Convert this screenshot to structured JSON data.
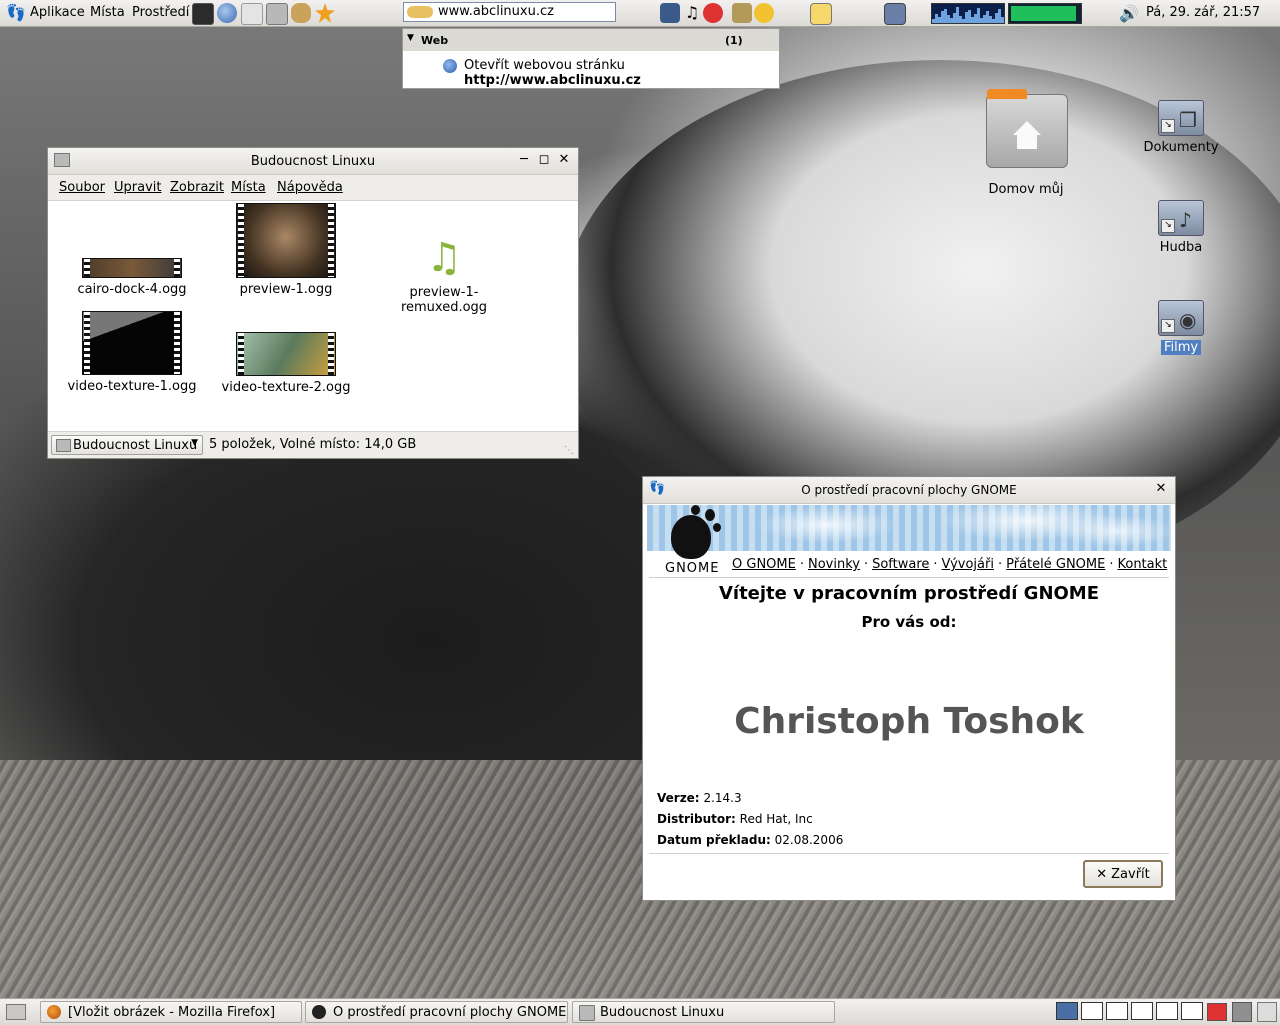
{
  "top_panel": {
    "menus": [
      "Aplikace",
      "Místa",
      "Prostředí"
    ],
    "launchers": [
      "terminal-icon",
      "globe-icon",
      "mail-icon",
      "calculator-icon",
      "gimp-icon",
      "star-icon"
    ],
    "url_value": "www.abclinuxu.cz",
    "tray_icons": [
      "network-icon",
      "music-icon",
      "alert-icon",
      "printer-icon",
      "smiley-icon",
      "windows-icon",
      "monitor-icon"
    ],
    "clock": "Pá, 29. zář, 21:57",
    "cpu_fill": 0.95
  },
  "url_dropdown": {
    "group": "Web",
    "count": "(1)",
    "action": "Otevřít webovou stránku",
    "url": "http://www.abclinuxu.cz"
  },
  "desktop_icons": {
    "home": "Domov můj",
    "documents": "Dokumenty",
    "music": "Hudba",
    "films": "Filmy"
  },
  "file_manager": {
    "title": "Budoucnost Linuxu",
    "menu": [
      "Soubor",
      "Upravit",
      "Zobrazit",
      "Místa",
      "Nápověda"
    ],
    "files": [
      {
        "name": "cairo-dock-4.ogg",
        "icon": "film-thumbnail"
      },
      {
        "name": "preview-1.ogg",
        "icon": "film-thumbnail"
      },
      {
        "name": "preview-1-remuxed.ogg",
        "icon": "music-note-icon"
      },
      {
        "name": "video-texture-1.ogg",
        "icon": "film-thumbnail"
      },
      {
        "name": "video-texture-2.ogg",
        "icon": "film-thumbnail"
      }
    ],
    "location": "Budoucnost Linuxu",
    "status": "5 položek, Volné místo: 14,0 GB"
  },
  "about": {
    "title": "O prostředí pracovní plochy GNOME",
    "logo_text": "GNOME",
    "links": [
      "O GNOME",
      "Novinky",
      "Software",
      "Vývojáři",
      "Přátelé GNOME",
      "Kontakt"
    ],
    "heading": "Vítejte v pracovním prostředí GNOME",
    "subheading": "Pro vás od:",
    "contributor": "Christoph Toshok",
    "version_label": "Verze:",
    "version": "2.14.3",
    "distributor_label": "Distributor:",
    "distributor": "Red Hat, Inc",
    "date_label": "Datum překladu:",
    "date": "02.08.2006",
    "close_label": "Zavřít"
  },
  "taskbar": {
    "tasks": [
      {
        "label": "[Vložit obrázek - Mozilla Firefox]",
        "icon": "firefox-icon"
      },
      {
        "label": "O prostředí pracovní plochy GNOME",
        "icon": "gnome-foot-icon"
      },
      {
        "label": "Budoucnost Linuxu",
        "icon": "folder-icon"
      }
    ]
  }
}
